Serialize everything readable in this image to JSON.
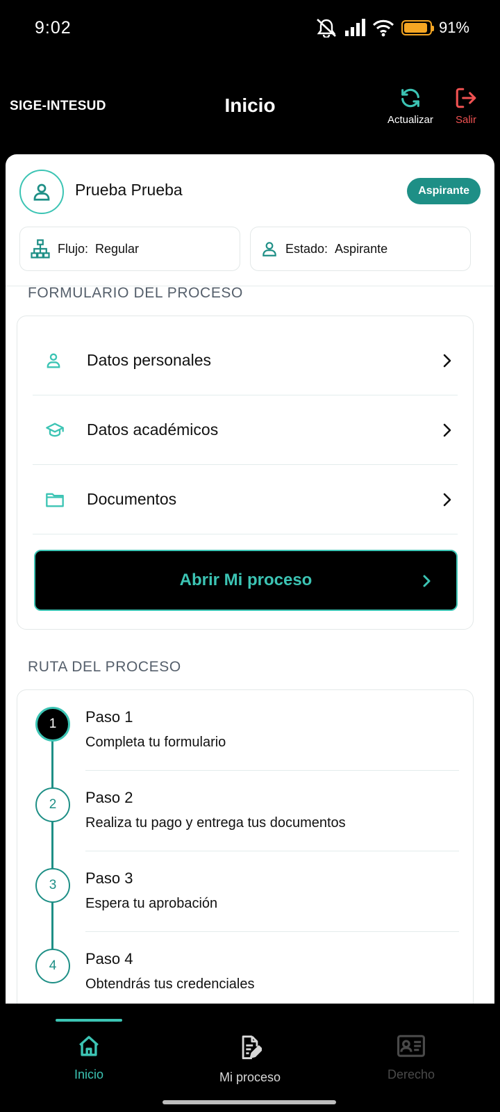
{
  "status": {
    "time": "9:02",
    "battery": "91%",
    "battery_level": 0.91
  },
  "header": {
    "brand": "SIGE-INTESUD",
    "title": "Inicio",
    "refresh_label": "Actualizar",
    "logout_label": "Salir"
  },
  "profile": {
    "name": "Prueba Prueba",
    "badge": "Aspirante",
    "flow_label": "Flujo:",
    "flow_value": "Regular",
    "state_label": "Estado:",
    "state_value": "Aspirante"
  },
  "form_section": {
    "title": "FORMULARIO DEL PROCESO",
    "items": [
      {
        "label": "Datos personales",
        "icon": "person-icon"
      },
      {
        "label": "Datos académicos",
        "icon": "graduation-cap-icon"
      },
      {
        "label": "Documentos",
        "icon": "folder-icon"
      }
    ],
    "open_button": "Abrir Mi proceso"
  },
  "route_section": {
    "title": "RUTA DEL PROCESO",
    "steps": [
      {
        "number": "1",
        "title": "Paso 1",
        "desc": "Completa tu formulario",
        "active": true
      },
      {
        "number": "2",
        "title": "Paso 2",
        "desc": "Realiza tu pago y entrega tus documentos",
        "active": false
      },
      {
        "number": "3",
        "title": "Paso 3",
        "desc": "Espera tu aprobación",
        "active": false
      },
      {
        "number": "4",
        "title": "Paso 4",
        "desc": "Obtendrás tus credenciales",
        "active": false
      }
    ]
  },
  "bottom_nav": {
    "items": [
      {
        "label": "Inicio"
      },
      {
        "label": "Mi proceso"
      },
      {
        "label": "Derecho"
      }
    ]
  },
  "colors": {
    "accent": "#3cc4b4",
    "accent_dark": "#1e8f86",
    "danger": "#f05252",
    "battery": "#f5a623"
  }
}
